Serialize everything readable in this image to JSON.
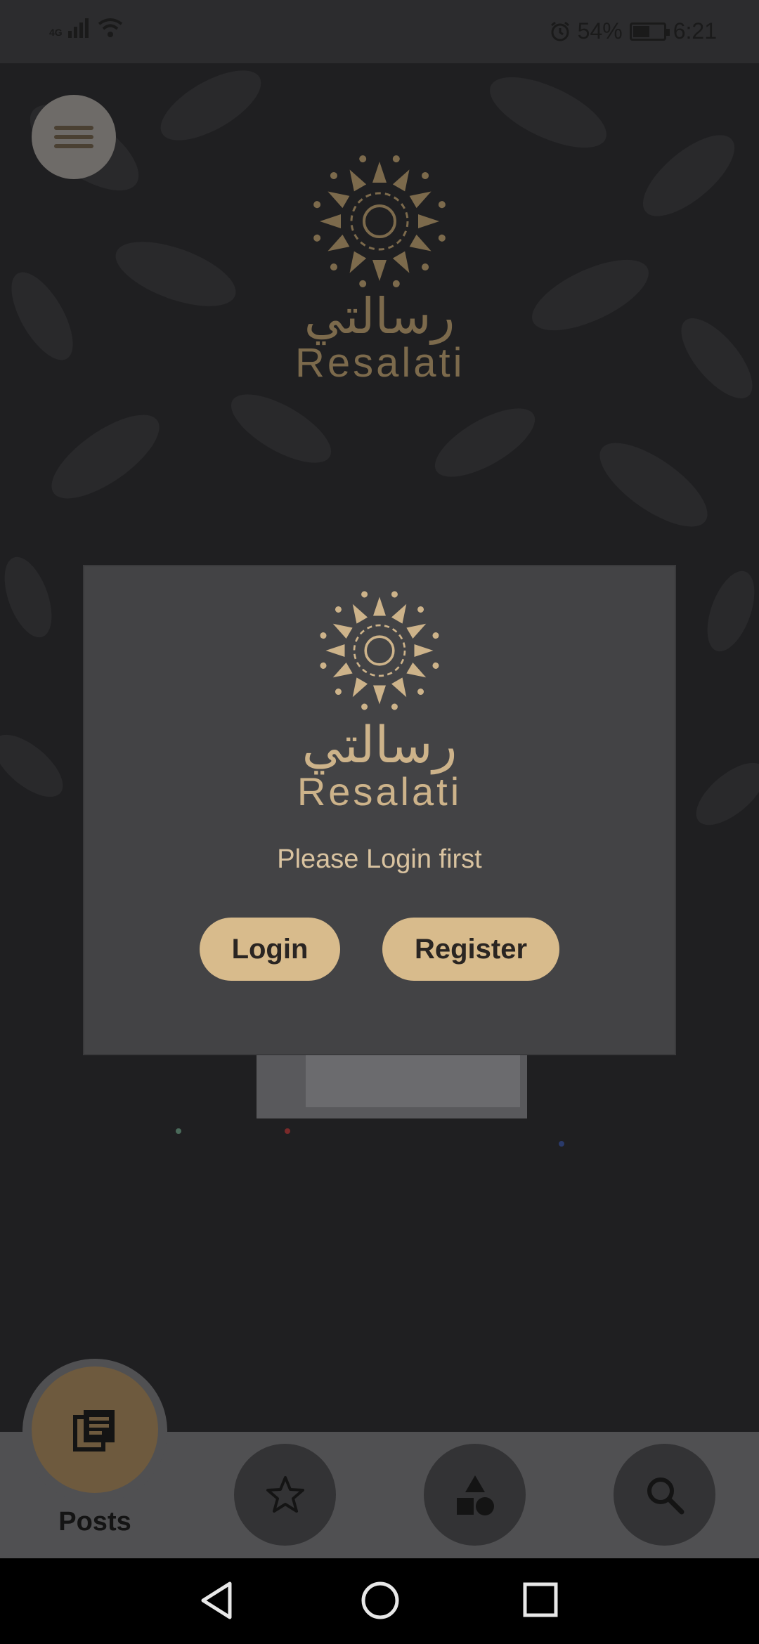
{
  "status_bar": {
    "network": "4G",
    "battery_text": "54%",
    "battery_level": 0.54,
    "time": "6:21"
  },
  "app": {
    "brand_arabic": "رسالتي",
    "brand_english": "Resalati"
  },
  "dialog": {
    "message": "Please Login first",
    "login_label": "Login",
    "register_label": "Register"
  },
  "bottom_nav": {
    "active_label": "Posts",
    "items": [
      {
        "icon": "posts-icon"
      },
      {
        "icon": "star-icon"
      },
      {
        "icon": "categories-icon"
      },
      {
        "icon": "search-icon"
      }
    ]
  },
  "colors": {
    "accent": "#d8bb8c",
    "dialog_bg": "#434345",
    "overlay_bg": "#1f1f21"
  }
}
